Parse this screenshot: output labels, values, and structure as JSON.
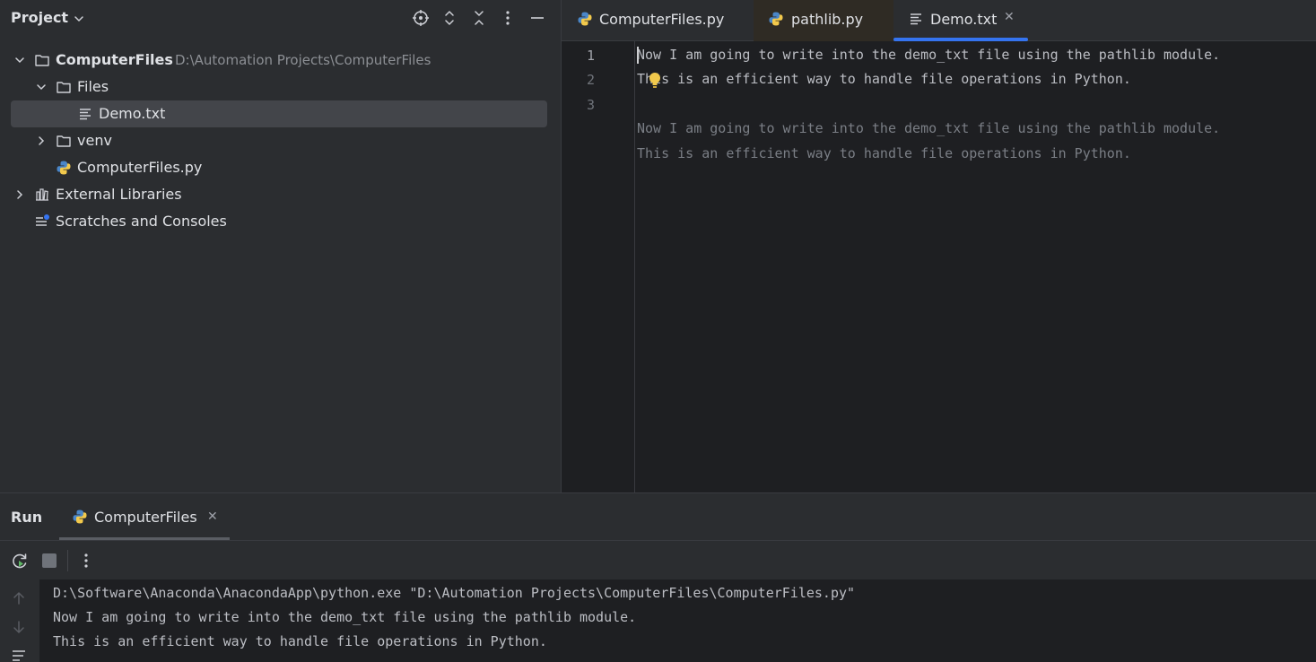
{
  "project": {
    "title": "Project",
    "tree": [
      {
        "label": "ComputerFiles",
        "path": "D:\\Automation Projects\\ComputerFiles",
        "icon": "folder-icon",
        "expanded": true
      },
      {
        "label": "Files",
        "icon": "folder-icon",
        "expanded": true
      },
      {
        "label": "Demo.txt",
        "icon": "text-file-icon",
        "selected": true
      },
      {
        "label": "venv",
        "icon": "folder-icon",
        "expanded": false
      },
      {
        "label": "ComputerFiles.py",
        "icon": "python-icon"
      },
      {
        "label": "External Libraries",
        "icon": "library-icon",
        "expanded": false
      },
      {
        "label": "Scratches and Consoles",
        "icon": "scratches-icon"
      }
    ]
  },
  "editor": {
    "tabs": [
      {
        "label": "ComputerFiles.py",
        "icon": "python-icon"
      },
      {
        "label": "pathlib.py",
        "icon": "python-icon"
      },
      {
        "label": "Demo.txt",
        "icon": "text-file-icon",
        "active": true,
        "close": "✕"
      }
    ],
    "line_numbers": [
      "1",
      "2",
      "3"
    ],
    "lines": [
      "Now I am going to write into the demo_txt file using the pathlib module.",
      "This is an efficient way to handle file operations in Python.",
      ""
    ],
    "preview_lines": [
      "Now I am going to write into the demo_txt file using the pathlib module.",
      "This is an efficient way to handle file operations in Python."
    ]
  },
  "run": {
    "title": "Run",
    "tab_label": "ComputerFiles",
    "tab_close": "✕",
    "console": [
      "D:\\Software\\Anaconda\\AnacondaApp\\python.exe \"D:\\Automation Projects\\ComputerFiles\\ComputerFiles.py\"",
      "Now I am going to write into the demo_txt file using the pathlib module.",
      "This is an efficient way to handle file operations in Python."
    ]
  },
  "colors": {
    "accent": "#3574f0",
    "panel_bg": "#2b2d30",
    "editor_bg": "#1e1f22"
  }
}
